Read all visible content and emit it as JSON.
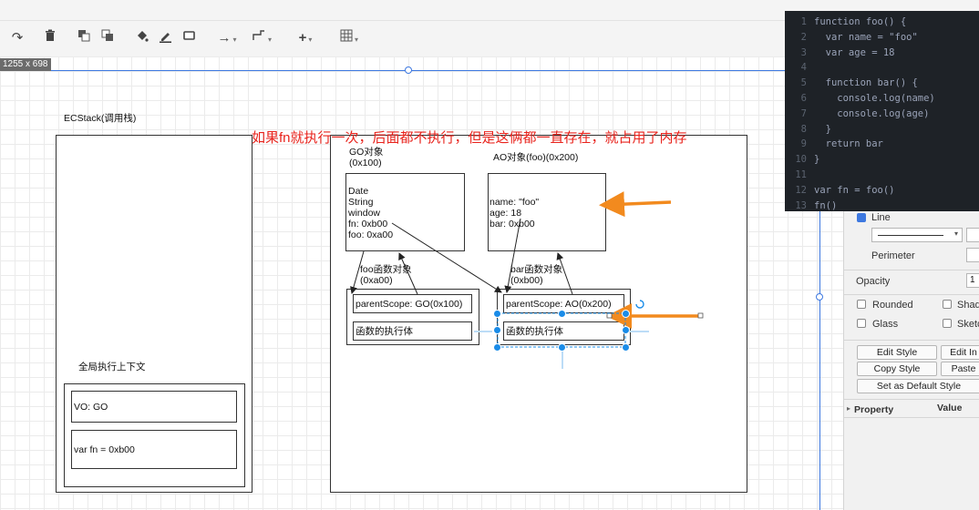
{
  "size_tip": "1255 x 698",
  "toolbar": {
    "redo_icon": "redo-icon",
    "delete_icon": "trash-icon",
    "to_front_icon": "to-front-icon",
    "to_back_icon": "to-back-icon",
    "fill_icon": "fill-bucket-icon",
    "line_color_icon": "pencil-icon",
    "shadow_icon": "shadow-icon",
    "connection_icon": "arrow-icon",
    "waypoints_icon": "waypoint-icon",
    "insert_icon": "plus-icon",
    "table_icon": "table-icon"
  },
  "diagram": {
    "ecstack_title": "ECStack(调用栈)",
    "global_ctx_title": "全局执行上下文",
    "vo_label": "VO: GO",
    "var_fn_label": "var fn = 0xb00",
    "annotation": "如果fn就执行一次，后面都不执行，但是这俩都一直存在，就占用了内存",
    "go_title": "GO对象\n(0x100)",
    "go_content": "Date\nString\nwindow\nfn: 0xb00\nfoo: 0xa00",
    "ao_title": "AO对象(foo)(0x200)",
    "ao_content": "name: \"foo\"\nage: 18\nbar: 0xb00",
    "foo_func_title": "foo函数对象\n(0xa00)",
    "foo_parent_scope": "parentScope: GO(0x100)",
    "foo_body": "函数的执行体",
    "bar_func_title": "bar函数对象\n(0xb00)",
    "bar_parent_scope": "parentScope: AO(0x200)",
    "bar_body": "函数的执行体",
    "accent_orange": "#f28a1e",
    "annotation_color": "#e8231c"
  },
  "code": {
    "lines": [
      {
        "n": "1",
        "t": "function foo() {"
      },
      {
        "n": "2",
        "t": "  var name = \"foo\""
      },
      {
        "n": "3",
        "t": "  var age = 18"
      },
      {
        "n": "4",
        "t": ""
      },
      {
        "n": "5",
        "t": "  function bar() {"
      },
      {
        "n": "6",
        "t": "    console.log(name)"
      },
      {
        "n": "7",
        "t": "    console.log(age)"
      },
      {
        "n": "8",
        "t": "  }"
      },
      {
        "n": "9",
        "t": "  return bar"
      },
      {
        "n": "10",
        "t": "}"
      },
      {
        "n": "11",
        "t": ""
      },
      {
        "n": "12",
        "t": "var fn = foo()"
      },
      {
        "n": "13",
        "t": "fn()"
      }
    ]
  },
  "panel": {
    "line_label": "Line",
    "perimeter_label": "Perimeter",
    "opacity_label": "Opacity",
    "opacity_value": "1",
    "rounded_label": "Rounded",
    "shadow_label": "Shad",
    "glass_label": "Glass",
    "sketch_label": "Sketc",
    "edit_style": "Edit Style",
    "edit_image": "Edit In",
    "copy_style": "Copy Style",
    "paste_style": "Paste",
    "default_style": "Set as Default Style",
    "property_header": "Property",
    "value_header": "Value"
  }
}
